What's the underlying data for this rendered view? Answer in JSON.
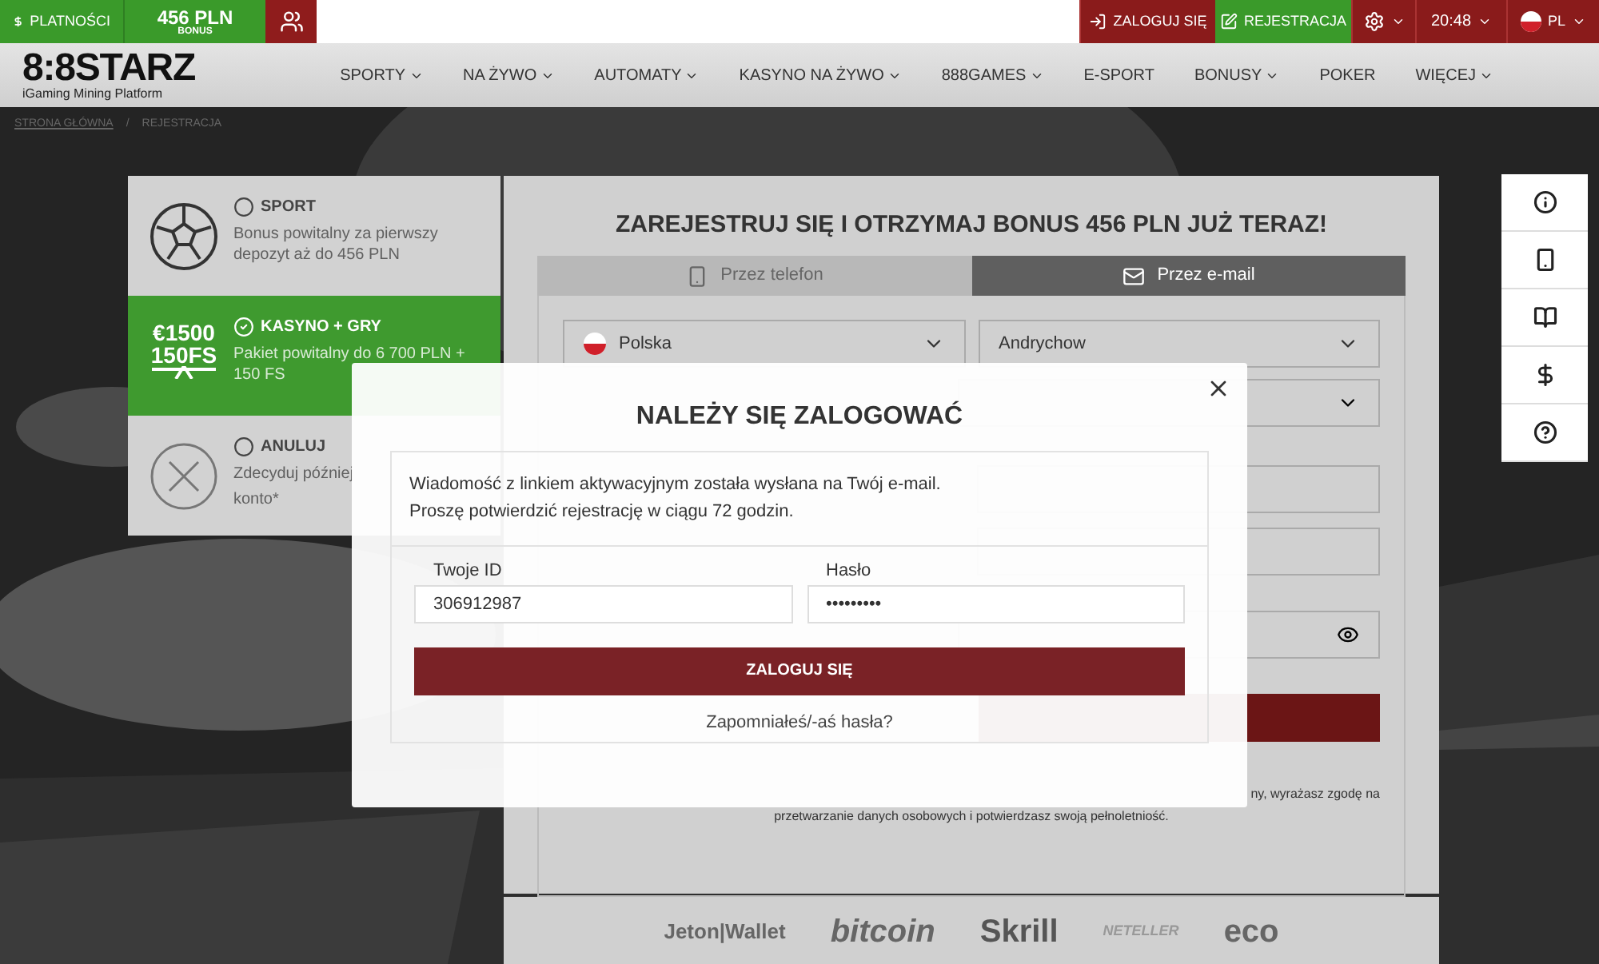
{
  "top_bar": {
    "left": [
      {
        "kind": "payments",
        "label": "PLATNOŚCI"
      },
      {
        "kind": "bonus",
        "label": "456 PLN",
        "sublabel": "BONUS"
      },
      {
        "kind": "group"
      }
    ],
    "right": [
      {
        "kind": "login",
        "label": "ZALOGUJ SIĘ"
      },
      {
        "kind": "register",
        "label": "REJESTRACJA"
      },
      {
        "kind": "settings"
      },
      {
        "kind": "time",
        "label": "20:48"
      },
      {
        "kind": "language",
        "label": "PL"
      }
    ]
  },
  "logo": {
    "text": "8:8STARZ",
    "tagline": "iGaming Mining Platform"
  },
  "nav": [
    {
      "label": "SPORTY",
      "dropdown": true
    },
    {
      "label": "NA ŻYWO",
      "dropdown": true
    },
    {
      "label": "AUTOMATY",
      "dropdown": true
    },
    {
      "label": "KASYNO NA ŻYWO",
      "dropdown": true
    },
    {
      "label": "888GAMES",
      "dropdown": true
    },
    {
      "label": "E-SPORT",
      "dropdown": false
    },
    {
      "label": "BONUSY",
      "dropdown": true
    },
    {
      "label": "POKER",
      "dropdown": false
    },
    {
      "label": "WIĘCEJ",
      "dropdown": true
    }
  ],
  "breadcrumbs": [
    "STRONA GŁÓWNA",
    "REJESTRACJA"
  ],
  "breadcrumb_separator": "/",
  "bonus_options": [
    {
      "kind": "sport",
      "title": "SPORT",
      "description": "Bonus powitalny za pierwszy depozyt aż do 456 PLN",
      "selected": false
    },
    {
      "kind": "casino",
      "title": "KASYNO + GRY",
      "description": "Pakiet powitalny do 6 700 PLN + 150 FS",
      "badge": "€1500",
      "badge_sub": "150FS",
      "selected": true
    },
    {
      "kind": "cancel",
      "title": "ANULUJ",
      "description": "Zdecyduj później",
      "description_end": "konto*",
      "selected": false
    }
  ],
  "form": {
    "heading": "ZAREJESTRUJ SIĘ I OTRZYMAJ BONUS 456 PLN JUŻ TERAZ!",
    "tabs": [
      {
        "kind": "phone",
        "label": "Przez telefon",
        "selected": false
      },
      {
        "kind": "email",
        "label": "Przez e-mail",
        "selected": true
      }
    ],
    "country": "Polska",
    "city": "Andrychow",
    "legal_line_end": "ny, wyrażasz zgodę na",
    "legal_line_2": "przetwarzanie danych osobowych i potwierdzasz swoją pełnoletniość."
  },
  "payment_logos": [
    "Jeton|Wallet",
    "bitcoin",
    "Skrill",
    "NETELLER",
    "eco"
  ],
  "side_tools": [
    {
      "kind": "info"
    },
    {
      "kind": "mobile"
    },
    {
      "kind": "book"
    },
    {
      "kind": "dollar"
    },
    {
      "kind": "help"
    }
  ],
  "modal": {
    "title": "NALEŻY SIĘ ZALOGOWAĆ",
    "message": [
      "Wiadomość z linkiem aktywacyjnym została wysłana na Twój e-mail.",
      "Proszę potwierdzić rejestrację w ciągu 72 godzin."
    ],
    "id_label": "Twoje ID",
    "id_value": "306912987",
    "password_label": "Hasło",
    "password_value": "•••••••••",
    "submit": "ZALOGUJ SIĘ",
    "forgot": "Zapomniałeś/-aś hasła?"
  }
}
